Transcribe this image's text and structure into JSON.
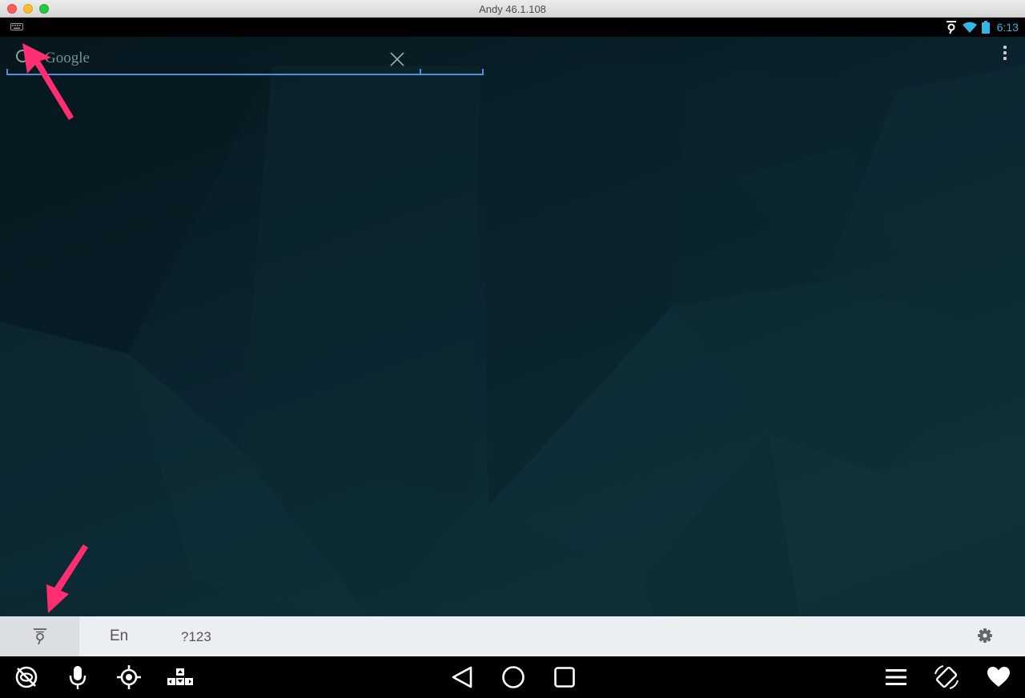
{
  "window": {
    "title": "Andy 46.1.108"
  },
  "statusbar": {
    "time": "6:13",
    "icons": [
      "keyboard-icon",
      "voice-input-icon",
      "wifi-icon",
      "battery-icon"
    ],
    "accent_color": "#33b5e5"
  },
  "search": {
    "placeholder": "Google"
  },
  "ime": {
    "language": "En",
    "symbols": "?123"
  },
  "navbar": {
    "left_icons": [
      "hide-icon",
      "microphone-icon",
      "location-icon",
      "gamepad-keys-icon"
    ],
    "center_icons": [
      "back-icon",
      "home-icon",
      "recents-icon"
    ],
    "right_icons": [
      "menu-icon",
      "rotate-icon",
      "heart-icon"
    ]
  },
  "annotations": {
    "arrow_color": "#ff2d72"
  }
}
